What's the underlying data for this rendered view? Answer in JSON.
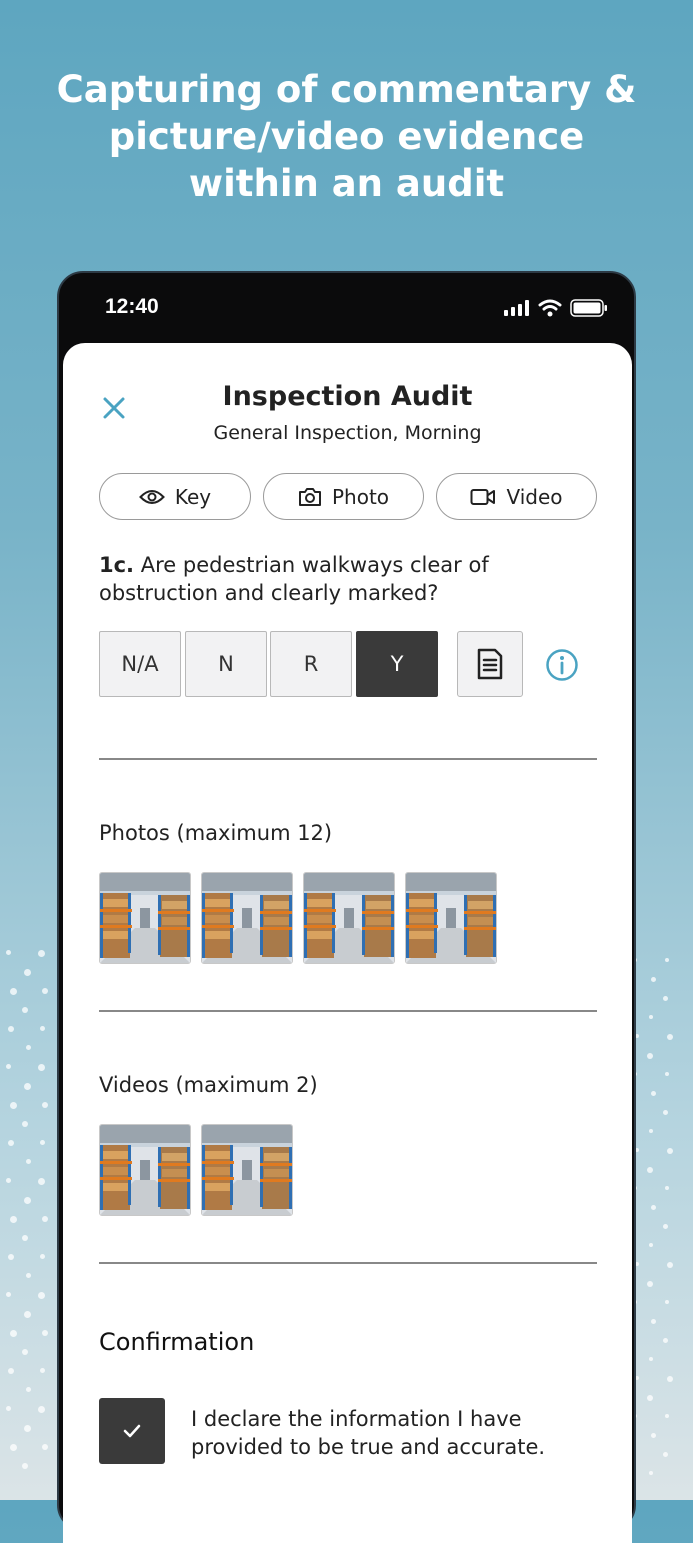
{
  "headline": "Capturing of commentary &\npicture/video evidence\nwithin an audit",
  "status_bar": {
    "time": "12:40"
  },
  "audit": {
    "title": "Inspection Audit",
    "subtitle": "General Inspection, Morning"
  },
  "actions": {
    "key_label": "Key",
    "photo_label": "Photo",
    "video_label": "Video"
  },
  "question": {
    "number": "1c.",
    "text": "Are pedestrian walkways clear of obstruction and clearly marked?"
  },
  "answers": {
    "options": [
      "N/A",
      "N",
      "R",
      "Y"
    ],
    "selected": "Y"
  },
  "photos": {
    "label": "Photos (maximum 12)"
  },
  "videos": {
    "label": "Videos (maximum 2)"
  },
  "confirmation": {
    "heading": "Confirmation",
    "checked": true,
    "text": "I declare the information I have\nprovided to be true and accurate."
  },
  "colors": {
    "accent": "#4aa3c2",
    "selected_answer": "#3a3a3a"
  }
}
